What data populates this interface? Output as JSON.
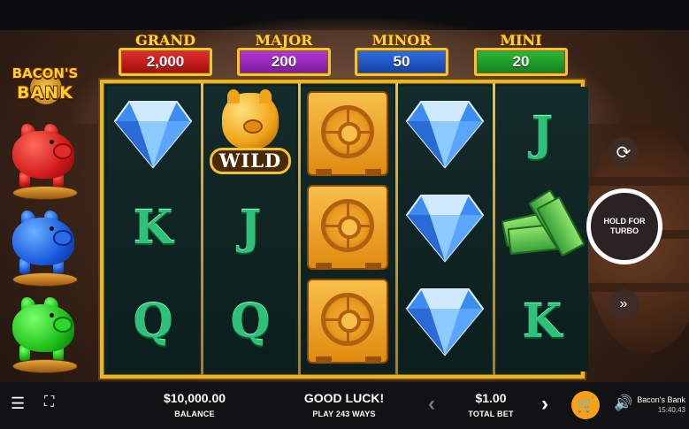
{
  "logo": {
    "line1": "BACON'S",
    "line2": "BANK"
  },
  "jackpots": [
    {
      "label": "GRAND",
      "value": "2,000",
      "color": "#c81818"
    },
    {
      "label": "MAJOR",
      "value": "200",
      "color": "#8a22b4"
    },
    {
      "label": "MINOR",
      "value": "50",
      "color": "#1e52c4"
    },
    {
      "label": "MINI",
      "value": "20",
      "color": "#1a9a28"
    }
  ],
  "piggy_banks": [
    "red",
    "blue",
    "green"
  ],
  "reels": [
    [
      "diamond",
      "K",
      "Q"
    ],
    [
      "wild",
      "J",
      "Q"
    ],
    [
      "safe",
      "safe",
      "safe"
    ],
    [
      "diamond",
      "diamond",
      "diamond"
    ],
    [
      "J",
      "cash",
      "K"
    ]
  ],
  "symbols": {
    "wild_label": "WILD",
    "letters": [
      "K",
      "Q",
      "J"
    ]
  },
  "controls": {
    "autoplay_icon": "autoplay-icon",
    "turbo_line1": "HOLD FOR",
    "turbo_line2": "TURBO",
    "fastforward_icon": "fast-forward-icon"
  },
  "bottom": {
    "balance_value": "$10,000.00",
    "balance_label": "BALANCE",
    "message": "GOOD LUCK!",
    "ways": "PLAY 243 WAYS",
    "bet_value": "$1.00",
    "bet_label": "TOTAL BET",
    "game_name": "Bacon's Bank",
    "time": "15:40:43"
  },
  "colors": {
    "frame_gold": "#e9b42c",
    "letter_green": "#2fc07a",
    "cart_orange": "#f6a117"
  }
}
